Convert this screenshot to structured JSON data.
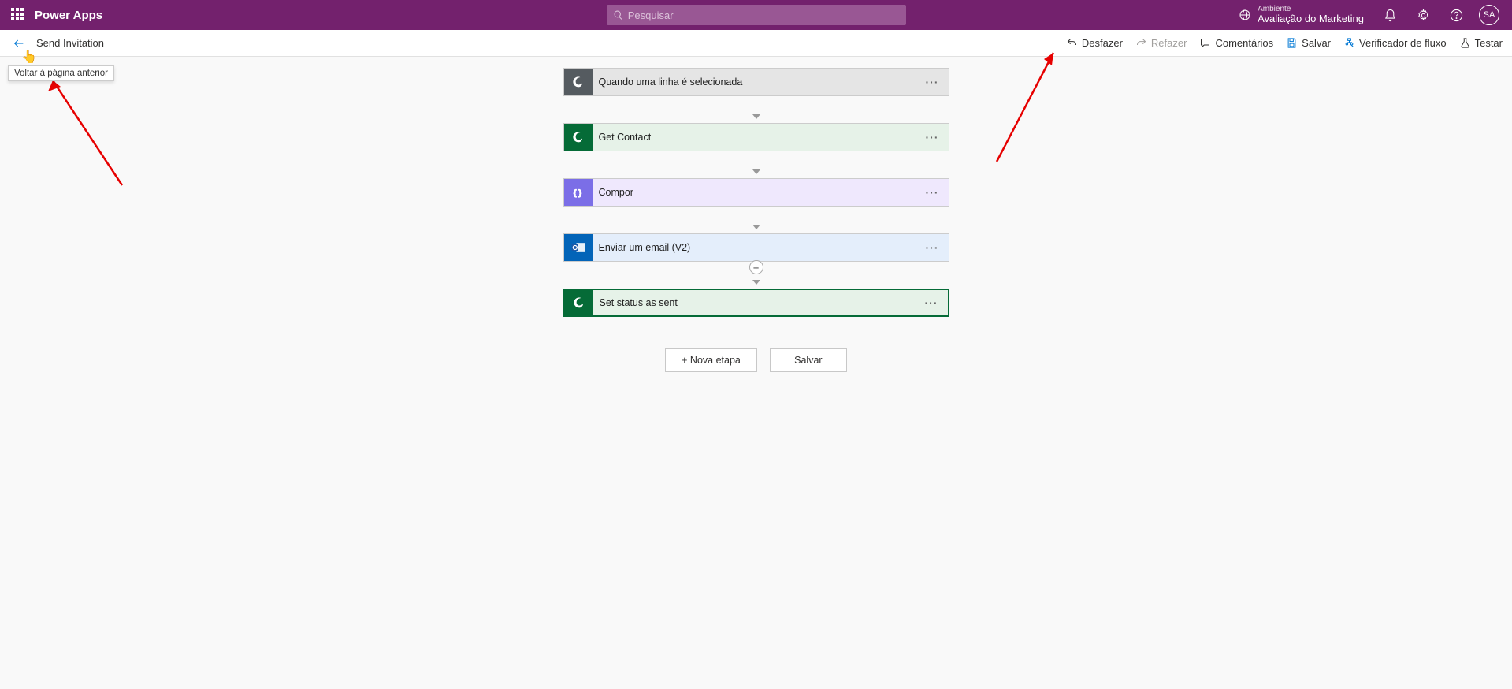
{
  "header": {
    "app_title": "Power Apps",
    "search_placeholder": "Pesquisar",
    "env_label": "Ambiente",
    "env_name": "Avaliação do Marketing",
    "avatar_initials": "SA"
  },
  "toolbar": {
    "flow_name": "Send Invitation",
    "tooltip": "Voltar à página anterior",
    "undo": "Desfazer",
    "redo": "Refazer",
    "comments": "Comentários",
    "save": "Salvar",
    "flow_checker": "Verificador de fluxo",
    "test": "Testar"
  },
  "steps": {
    "trigger": "Quando uma linha é selecionada",
    "get_contact": "Get Contact",
    "compose": "Compor",
    "send_email": "Enviar um email (V2)",
    "set_status": "Set status as sent"
  },
  "buttons": {
    "new_step": "+ Nova etapa",
    "save": "Salvar",
    "add": "+"
  }
}
